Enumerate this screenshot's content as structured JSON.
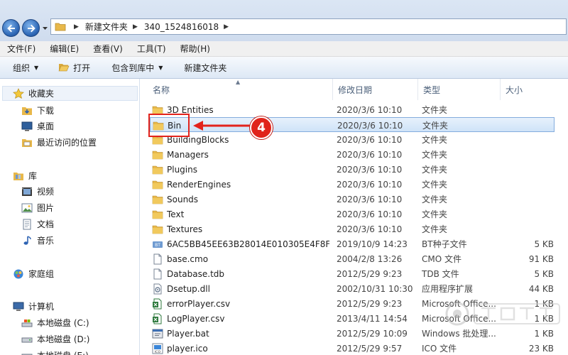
{
  "address": {
    "crumbs": [
      "新建文件夹",
      "340_1524816018"
    ]
  },
  "menu": [
    "文件(F)",
    "编辑(E)",
    "查看(V)",
    "工具(T)",
    "帮助(H)"
  ],
  "commands": {
    "organize": "组织",
    "open": "打开",
    "include": "包含到库中",
    "new_folder": "新建文件夹"
  },
  "nav": {
    "favorites": "收藏夹",
    "downloads": "下载",
    "desktop": "桌面",
    "recent": "最近访问的位置",
    "libraries": "库",
    "videos": "视频",
    "pictures": "图片",
    "documents": "文档",
    "music": "音乐",
    "homegroup": "家庭组",
    "computer": "计算机",
    "drive_c": "本地磁盘 (C:)",
    "drive_d": "本地磁盘 (D:)",
    "drive_e": "本地磁盘 (E:)"
  },
  "columns": {
    "name": "名称",
    "date": "修改日期",
    "type": "类型",
    "size": "大小"
  },
  "files": [
    {
      "name": "3D Entities",
      "date": "2020/3/6 10:10",
      "type": "文件夹",
      "size": "",
      "icon": "folder-icon"
    },
    {
      "name": "Bin",
      "date": "2020/3/6 10:10",
      "type": "文件夹",
      "size": "",
      "icon": "folder-icon"
    },
    {
      "name": "BuildingBlocks",
      "date": "2020/3/6 10:10",
      "type": "文件夹",
      "size": "",
      "icon": "folder-icon"
    },
    {
      "name": "Managers",
      "date": "2020/3/6 10:10",
      "type": "文件夹",
      "size": "",
      "icon": "folder-icon"
    },
    {
      "name": "Plugins",
      "date": "2020/3/6 10:10",
      "type": "文件夹",
      "size": "",
      "icon": "folder-icon"
    },
    {
      "name": "RenderEngines",
      "date": "2020/3/6 10:10",
      "type": "文件夹",
      "size": "",
      "icon": "folder-icon"
    },
    {
      "name": "Sounds",
      "date": "2020/3/6 10:10",
      "type": "文件夹",
      "size": "",
      "icon": "folder-icon"
    },
    {
      "name": "Text",
      "date": "2020/3/6 10:10",
      "type": "文件夹",
      "size": "",
      "icon": "folder-icon"
    },
    {
      "name": "Textures",
      "date": "2020/3/6 10:10",
      "type": "文件夹",
      "size": "",
      "icon": "folder-icon"
    },
    {
      "name": "6AC5BB45EE63B28014E010305E4F8F...",
      "date": "2019/10/9 14:23",
      "type": "BT种子文件",
      "size": "5 KB",
      "icon": "torrent-file-icon"
    },
    {
      "name": "base.cmo",
      "date": "2004/2/8 13:26",
      "type": "CMO 文件",
      "size": "91 KB",
      "icon": "blank-file-icon"
    },
    {
      "name": "Database.tdb",
      "date": "2012/5/29 9:23",
      "type": "TDB 文件",
      "size": "5 KB",
      "icon": "blank-file-icon"
    },
    {
      "name": "Dsetup.dll",
      "date": "2002/10/31 10:30",
      "type": "应用程序扩展",
      "size": "44 KB",
      "icon": "dll-file-icon"
    },
    {
      "name": "errorPlayer.csv",
      "date": "2012/5/29 9:23",
      "type": "Microsoft Office...",
      "size": "1 KB",
      "icon": "excel-file-icon"
    },
    {
      "name": "LogPlayer.csv",
      "date": "2013/4/11 14:54",
      "type": "Microsoft Office...",
      "size": "1 KB",
      "icon": "excel-file-icon"
    },
    {
      "name": "Player.bat",
      "date": "2012/5/29 10:09",
      "type": "Windows 批处理...",
      "size": "1 KB",
      "icon": "batch-file-icon"
    },
    {
      "name": "player.ico",
      "date": "2012/5/29 9:57",
      "type": "ICO 文件",
      "size": "23 KB",
      "icon": "ico-file-icon"
    }
  ],
  "annotation": {
    "step": "4"
  },
  "colors": {
    "accent": "#e0241b",
    "selection": "#cfe3f8",
    "folder": "#e8b84a"
  }
}
